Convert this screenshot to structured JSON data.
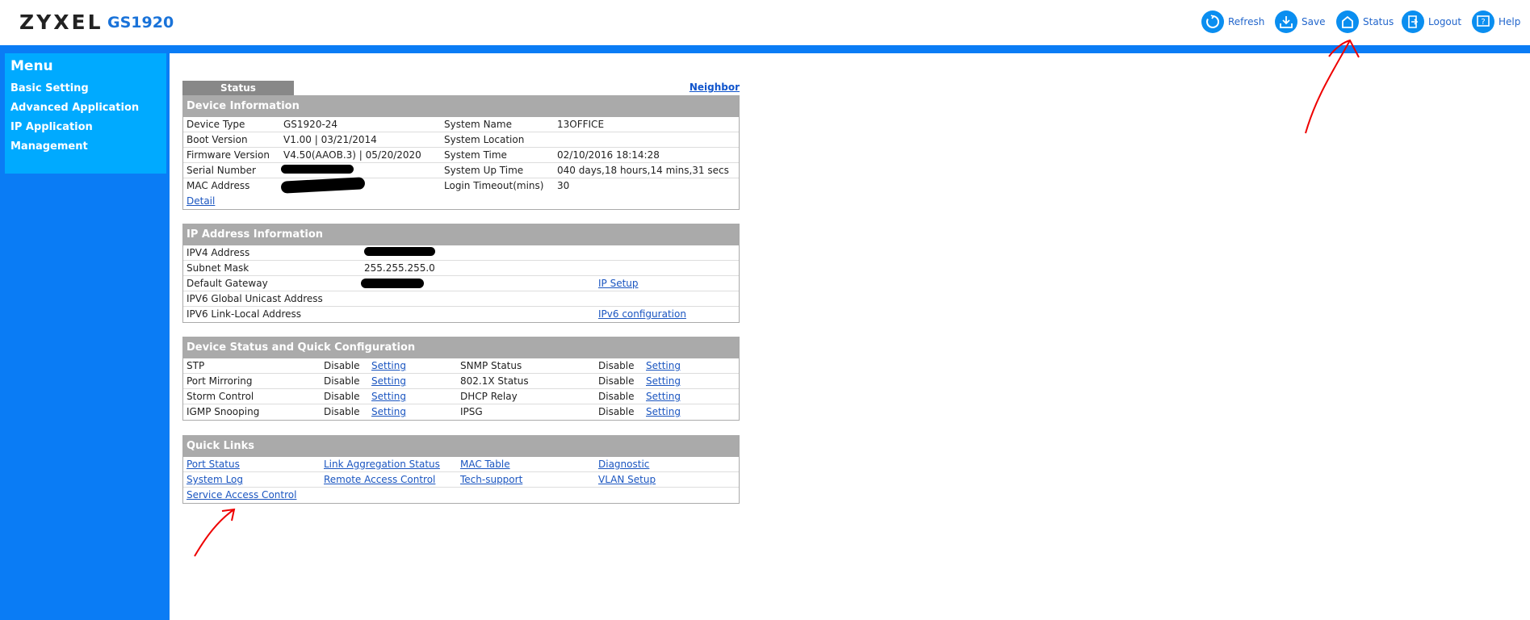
{
  "header": {
    "brand": "ZYXEL",
    "model": "GS1920",
    "toolbar": [
      {
        "label": "Refresh",
        "icon": "refresh-icon"
      },
      {
        "label": "Save",
        "icon": "save-icon"
      },
      {
        "label": "Status",
        "icon": "home-icon"
      },
      {
        "label": "Logout",
        "icon": "logout-icon"
      },
      {
        "label": "Help",
        "icon": "help-icon"
      }
    ]
  },
  "colors": {
    "accent": "#0a7cf5",
    "menu": "#00aaff",
    "section_header": "#aaaaaa"
  },
  "menu": {
    "title": "Menu",
    "items": [
      "Basic Setting",
      "Advanced Application",
      "IP Application",
      "Management"
    ]
  },
  "tab": "Status",
  "neighbor": "Neighbor",
  "device_info": {
    "title": "Device Information",
    "rows": [
      [
        "Device Type",
        "GS1920-24",
        "System Name",
        "13OFFICE"
      ],
      [
        "Boot Version",
        "V1.00 | 03/21/2014",
        "System Location",
        ""
      ],
      [
        "Firmware Version",
        "V4.50(AAOB.3) | 05/20/2020",
        "System Time",
        "02/10/2016 18:14:28"
      ],
      [
        "Serial Number",
        "",
        "System Up Time",
        "040 days,18 hours,14 mins,31 secs"
      ],
      [
        "MAC Address",
        "",
        "Login Timeout(mins)",
        "30"
      ]
    ],
    "detail": "Detail"
  },
  "ip_info": {
    "title": "IP Address Information",
    "rows": [
      [
        "IPV4 Address",
        "",
        ""
      ],
      [
        "Subnet Mask",
        "255.255.255.0",
        ""
      ],
      [
        "Default Gateway",
        "",
        "IP Setup"
      ],
      [
        "IPV6 Global Unicast Address",
        "",
        ""
      ],
      [
        "IPV6 Link-Local Address",
        "",
        "IPv6 configuration"
      ]
    ]
  },
  "device_status": {
    "title": "Device Status and Quick Configuration",
    "setting": "Setting",
    "rows": [
      [
        "STP",
        "Disable",
        "SNMP Status",
        "Disable"
      ],
      [
        "Port Mirroring",
        "Disable",
        "802.1X Status",
        "Disable"
      ],
      [
        "Storm Control",
        "Disable",
        "DHCP Relay",
        "Disable"
      ],
      [
        "IGMP Snooping",
        "Disable",
        "IPSG",
        "Disable"
      ]
    ]
  },
  "quick_links": {
    "title": "Quick Links",
    "rows": [
      [
        "Port Status",
        "Link Aggregation Status",
        "MAC Table",
        "Diagnostic"
      ],
      [
        "System Log",
        "Remote Access Control",
        "Tech-support",
        "VLAN Setup"
      ],
      [
        "Service Access Control",
        "",
        "",
        ""
      ]
    ]
  }
}
